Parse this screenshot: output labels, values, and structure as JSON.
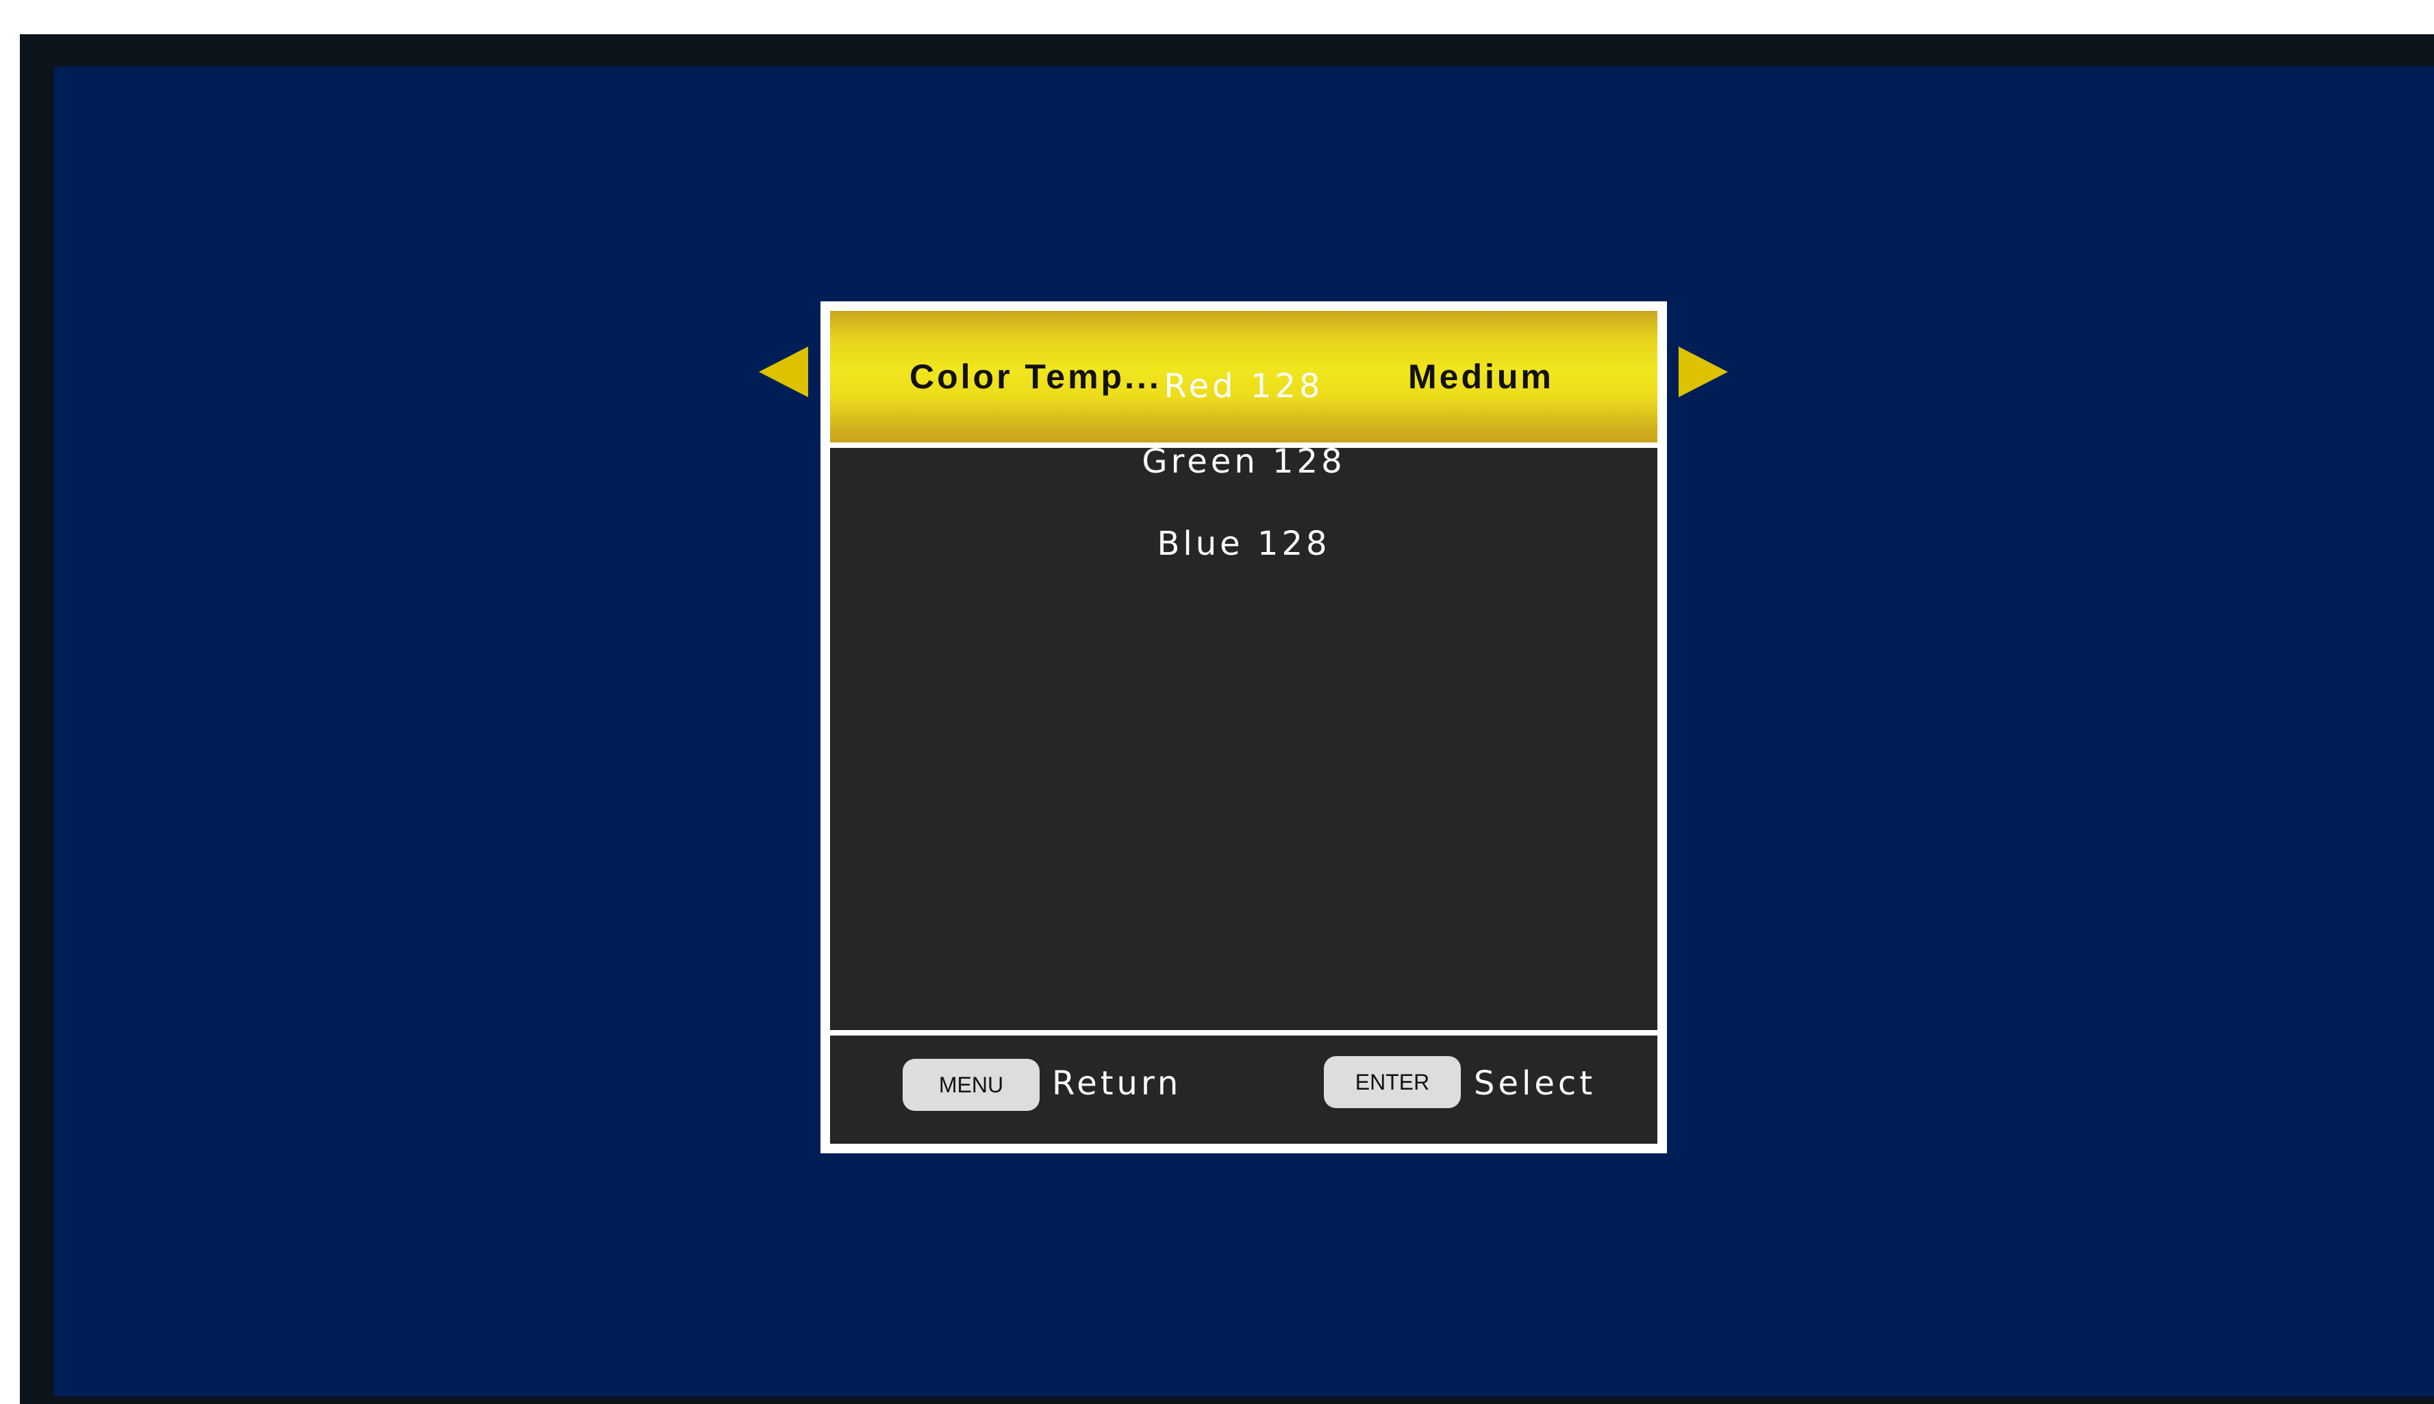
{
  "osd": {
    "header": {
      "label": "Color Temp...",
      "value": "Medium"
    },
    "body": {
      "lines": [
        "Red 128",
        "Green 128",
        "Blue 128"
      ]
    },
    "footer": {
      "menu_key": "MENU",
      "menu_caption": "Return",
      "enter_key": "ENTER",
      "enter_caption": "Select"
    }
  },
  "colors": {
    "screen_background": "#001e56",
    "bezel": "#0b131b",
    "panel_background": "#262626",
    "panel_border": "#ffffff",
    "header_highlight": "#f0e61e",
    "arrow": "#dcc200"
  },
  "icons": {
    "left": "triangle-left-icon",
    "right": "triangle-right-icon"
  }
}
